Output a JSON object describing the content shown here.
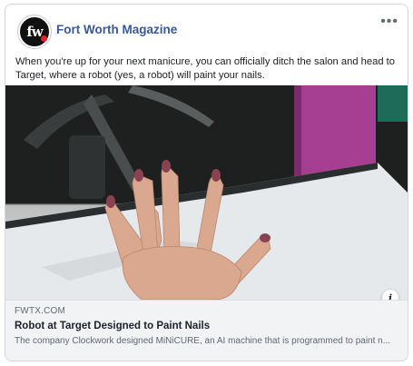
{
  "post": {
    "page_name": "Fort Worth Magazine",
    "avatar_text": "fw",
    "more_icon": "more-options-icon",
    "more_label": "•••",
    "text": "When you're up for your next manicure, you can officially ditch the salon and head to Target, where a robot (yes, a robot) will paint your nails."
  },
  "link_preview": {
    "domain": "FWTX.COM",
    "title": "Robot at Target Designed to Paint Nails",
    "description": "The company Clockwork designed MiNiCURE, an AI machine that is programmed to paint n...",
    "info_icon": "info-icon",
    "info_label": "i"
  },
  "colors": {
    "page_name": "#385898",
    "link_bg": "#f2f3f5",
    "robot_accent": "#a63e92"
  }
}
